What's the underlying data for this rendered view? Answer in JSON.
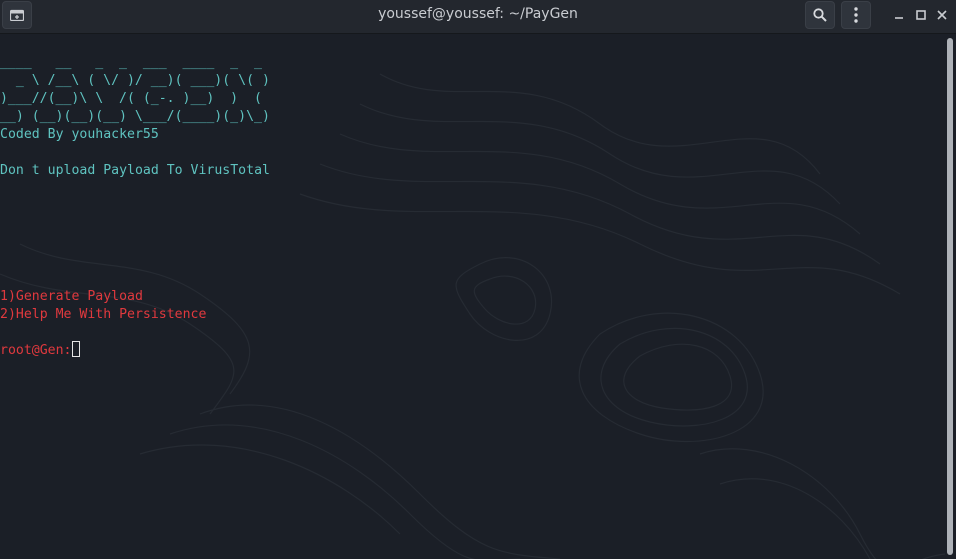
{
  "window": {
    "title": "youssef@youssef: ~/PayGen",
    "icons": {
      "new_tab": "new-tab-icon",
      "search": "search-icon",
      "menu": "kebab-menu-icon",
      "minimize": "minimize-icon",
      "maximize": "maximize-icon",
      "close": "close-icon"
    }
  },
  "terminal": {
    "banner": [
      " ____   __   _  _  ___  ____  _  _ ",
      "(  _ \\ /__\\ ( \\/ )/ __)( ___)( \\( )",
      " )___//(__)\\ \\  /( (_-. )__)  )  ( ",
      "(__) (__)(__)(__) \\___/(____)(_)\\_)"
    ],
    "credit": "Coded By youhacker55",
    "warning": "Don t upload Payload To VirusTotal",
    "menu": [
      "1)Generate Payload",
      "2)Help Me With Persistence"
    ],
    "prompt": "root@Gen:"
  },
  "colors": {
    "background": "#1b1f27",
    "banner_text": "#5fc3c0",
    "menu_text": "#e0393e",
    "titlebar": "#23272e"
  }
}
